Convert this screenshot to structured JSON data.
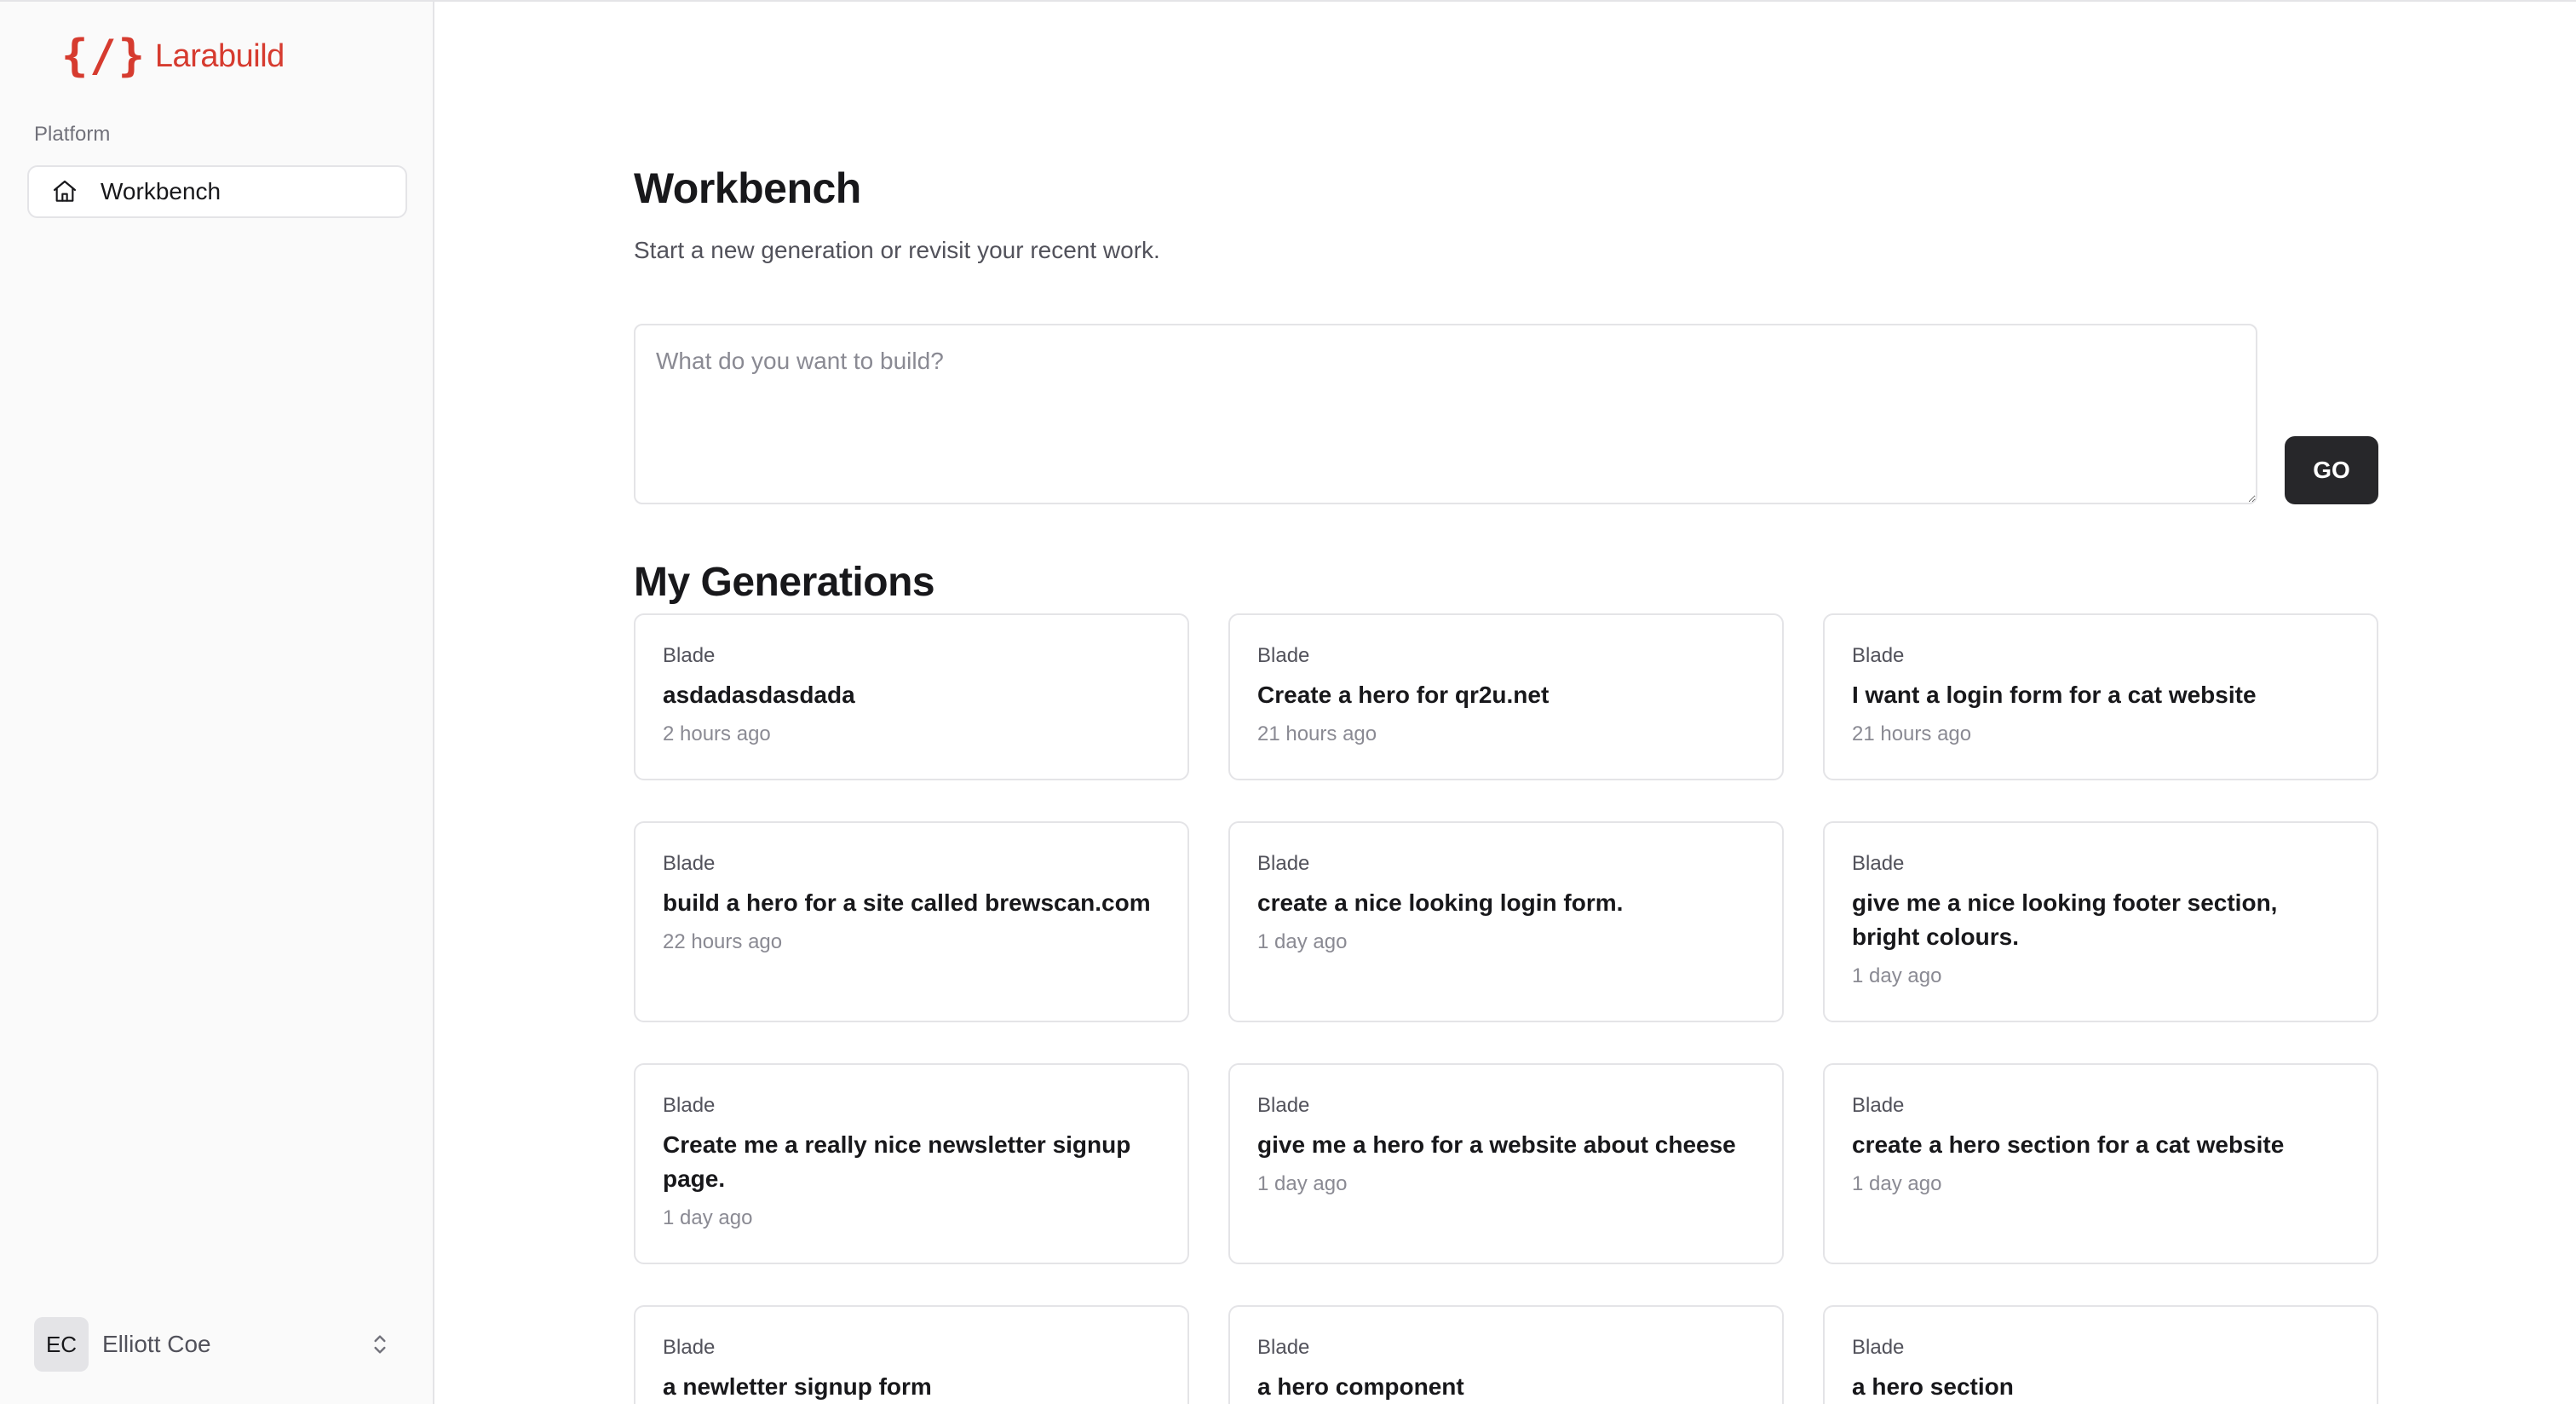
{
  "sidebar": {
    "logo_mark": "{/}",
    "logo_text": "Larabuild",
    "section_label": "Platform",
    "items": [
      {
        "label": "Workbench",
        "icon": "home-icon"
      }
    ],
    "user": {
      "initials": "EC",
      "name": "Elliott Coe"
    }
  },
  "main": {
    "title": "Workbench",
    "subtitle": "Start a new generation or revisit your recent work.",
    "prompt": {
      "placeholder": "What do you want to build?",
      "value": ""
    },
    "go_label": "GO",
    "generations_title": "My Generations",
    "generations": [
      {
        "type": "Blade",
        "title": "asdadasdasdada",
        "time": "2 hours ago"
      },
      {
        "type": "Blade",
        "title": "Create a hero for qr2u.net",
        "time": "21 hours ago"
      },
      {
        "type": "Blade",
        "title": "I want a login form for a cat website",
        "time": "21 hours ago"
      },
      {
        "type": "Blade",
        "title": "build a hero for a site called brewscan.com",
        "time": "22 hours ago"
      },
      {
        "type": "Blade",
        "title": "create a nice looking login form.",
        "time": "1 day ago"
      },
      {
        "type": "Blade",
        "title": "give me a nice looking footer section, bright colours.",
        "time": "1 day ago"
      },
      {
        "type": "Blade",
        "title": "Create me a really nice newsletter signup page.",
        "time": "1 day ago"
      },
      {
        "type": "Blade",
        "title": "give me a hero for a website about cheese",
        "time": "1 day ago"
      },
      {
        "type": "Blade",
        "title": "create a hero section for a cat website",
        "time": "1 day ago"
      },
      {
        "type": "Blade",
        "title": "a newletter signup form",
        "time": ""
      },
      {
        "type": "Blade",
        "title": "a hero component",
        "time": ""
      },
      {
        "type": "Blade",
        "title": "a hero section",
        "time": ""
      }
    ]
  },
  "colors": {
    "brand": "#d63b2f",
    "button_bg": "#27272a",
    "sidebar_bg": "#fafafa",
    "border": "#e4e4e7"
  }
}
